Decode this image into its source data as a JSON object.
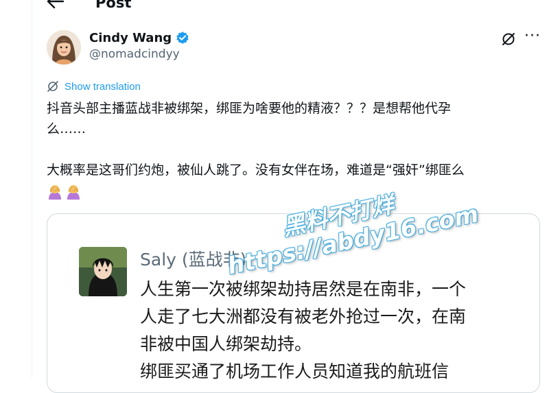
{
  "header": {
    "title": "Post",
    "back_icon": "arrow-left-icon"
  },
  "author": {
    "name": "Cindy Wang",
    "handle": "@nomadcindyy",
    "verified": true,
    "verified_color": "#1d9bf0"
  },
  "actions": {
    "grok_icon": "grok-icon",
    "more_icon": "more-dots-icon"
  },
  "translation": {
    "label": "Show translation",
    "color": "#1d9bf0"
  },
  "tweet": {
    "line1": "抖音头部主播蓝战非被绑架，绑匪为啥要他的精液？？？是想帮他代孕",
    "line2": "么……",
    "line3": "大概率是这哥们约炮，被仙人跳了。没有女伴在场，难道是“强奸”绑匪么",
    "emojis": [
      "woman-facepalming-emoji",
      "woman-facepalming-emoji"
    ]
  },
  "quoted": {
    "name": "Saly (蓝战非)",
    "lines": [
      "人生第一次被绑架劫持居然是在南非，一个",
      "人走了七大洲都没有被老外抢过一次，在南",
      "非被中国人绑架劫持。",
      "绑匪买通了机场工作人员知道我的航班信"
    ]
  },
  "watermark": {
    "line1": "黑料不打烊",
    "line2": "https://abdy16.com"
  }
}
